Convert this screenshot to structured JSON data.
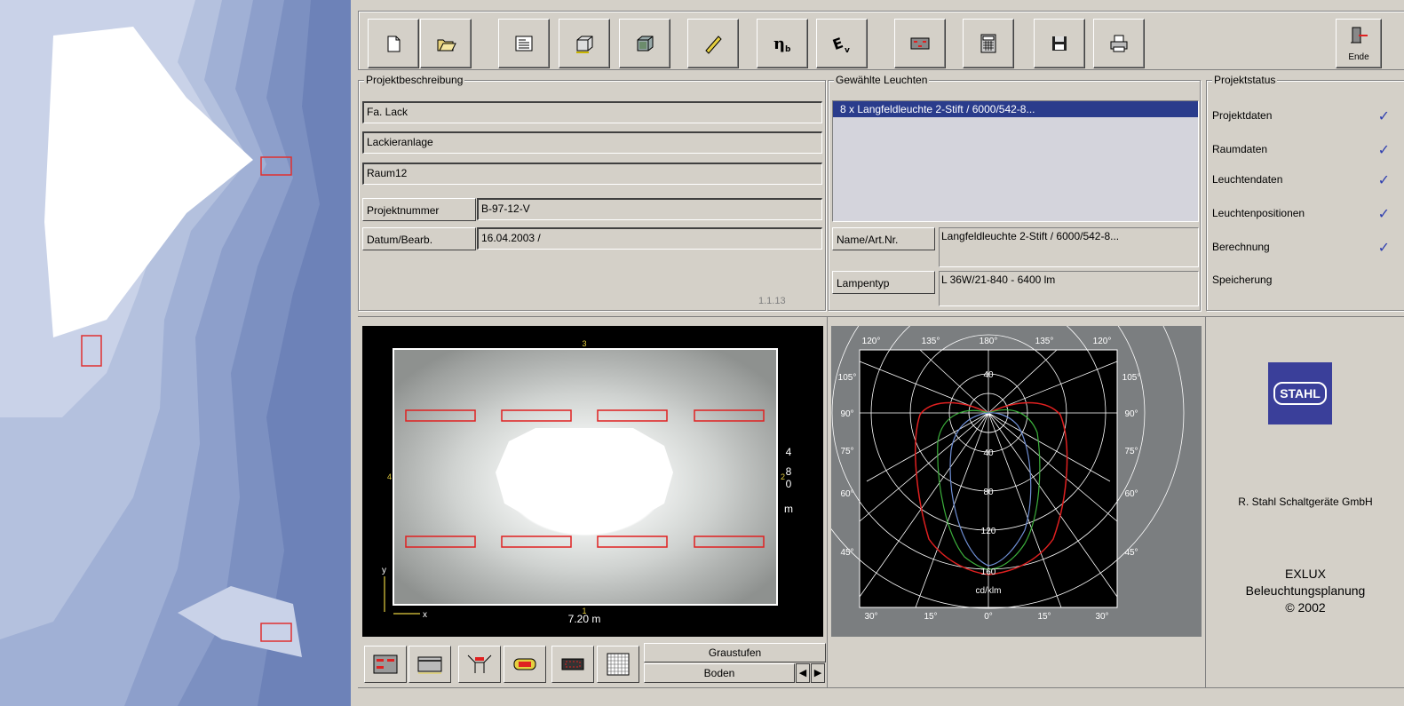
{
  "toolbar": {
    "buttons": [
      "new-document",
      "open-folder",
      "project-description",
      "room-box",
      "room-textured",
      "luminaire-bar",
      "greek-n-b",
      "greek-e-v",
      "positions",
      "calculator",
      "save-disk",
      "printer"
    ],
    "ende_label": "Ende"
  },
  "projekt": {
    "title": "Projektbeschreibung",
    "line1": "Fa. Lack",
    "line2": "Lackieranlage",
    "line3": "Raum12",
    "nummer_label": "Projektnummer",
    "nummer_value": "B-97-12-V",
    "datum_label": "Datum/Bearb.",
    "datum_value": "16.04.2003 /",
    "version": "1.1.13"
  },
  "leuchten": {
    "title": "Gewählte Leuchten",
    "selected_item": "8 x Langfeldleuchte 2-Stift / 6000/542-8...",
    "name_label": "Name/Art.Nr.",
    "name_value": "Langfeldleuchte 2-Stift / 6000/542-8...",
    "lampentyp_label": "Lampentyp",
    "lampentyp_value": "L 36W/21-840  - 6400 lm"
  },
  "status": {
    "title": "Projektstatus",
    "items": [
      {
        "label": "Projektdaten",
        "check": "✓"
      },
      {
        "label": "Raumdaten",
        "check": "✓"
      },
      {
        "label": "Leuchtendaten",
        "check": "✓"
      },
      {
        "label": "Leuchtenpositionen",
        "check": "✓"
      },
      {
        "label": "Berechnung",
        "check": "✓"
      },
      {
        "label": "Speicherung",
        "check": ""
      }
    ]
  },
  "plan": {
    "top_marker": "3",
    "right_marker": "2",
    "left_marker": "4",
    "bottom_marker": "1",
    "width_label": "7.20 m",
    "height_digits": [
      "4",
      "8",
      "0"
    ],
    "height_unit": "m",
    "axis_x": "x",
    "axis_y": "y"
  },
  "polar": {
    "top_labels": [
      "120°",
      "135°",
      "180°",
      "135°",
      "120°"
    ],
    "left_labels": [
      "105°",
      "90°",
      "75°",
      "60°",
      "45°"
    ],
    "right_labels": [
      "105°",
      "90°",
      "75°",
      "60°",
      "45°"
    ],
    "bottom_labels": [
      "30°",
      "15°",
      "0°",
      "15°",
      "30°"
    ],
    "ring_labels": [
      "40",
      "40",
      "80",
      "120",
      "160"
    ],
    "unit": "cd/klm"
  },
  "brand": {
    "logo_text": "STAHL",
    "company": "R. Stahl Schaltgeräte GmbH",
    "product": "EXLUX",
    "subtitle": "Beleuchtungsplanung",
    "copyright": "© 2002"
  },
  "controls": {
    "graustufen": "Graustufen",
    "boden": "Boden",
    "prev_arrow": "◀",
    "next_arrow": "▶"
  },
  "colors": {
    "selection": "#2a3c8c",
    "check": "#2f3fb0",
    "luminaire": "#e02020",
    "logo_bg": "#3a3f9a"
  }
}
